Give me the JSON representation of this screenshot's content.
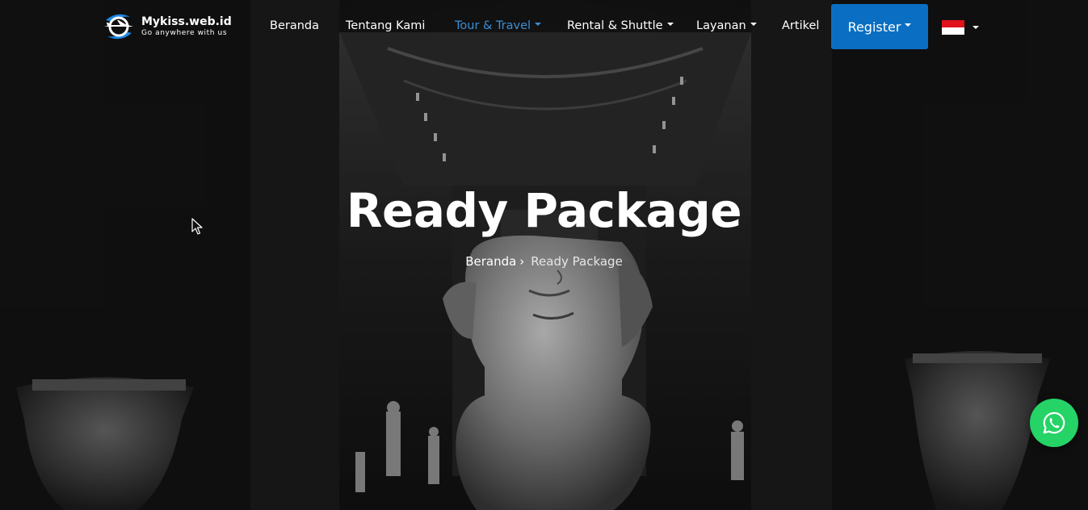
{
  "brand": {
    "name": "Mykiss.web.id",
    "tagline": "Go anywhere with us",
    "logo_icon": "plane-swirl-logo-icon",
    "accent": "#1e88e5"
  },
  "nav": {
    "items": [
      {
        "label": "Beranda",
        "dropdown": false,
        "active": false
      },
      {
        "label": "Tentang Kami",
        "dropdown": false,
        "active": false
      },
      {
        "label": "Tour & Travel",
        "dropdown": true,
        "active": true
      },
      {
        "label": "Rental & Shuttle",
        "dropdown": true,
        "active": false
      },
      {
        "label": "Layanan",
        "dropdown": true,
        "active": false
      },
      {
        "label": "Artikel",
        "dropdown": false,
        "active": false
      }
    ],
    "active_color": "#3a8fd6",
    "register_label": "Register",
    "register_color": "#0a6fc2",
    "language": {
      "icon": "indonesia-flag-icon",
      "flag_colors": [
        "#e0121c",
        "#ffffff"
      ]
    }
  },
  "hero": {
    "title": "Ready Package",
    "breadcrumb": {
      "home": "Beranda",
      "separator_icon": "chevron-right-icon",
      "current": "Ready Package"
    }
  },
  "whatsapp": {
    "icon": "whatsapp-icon",
    "color": "#25d366"
  }
}
